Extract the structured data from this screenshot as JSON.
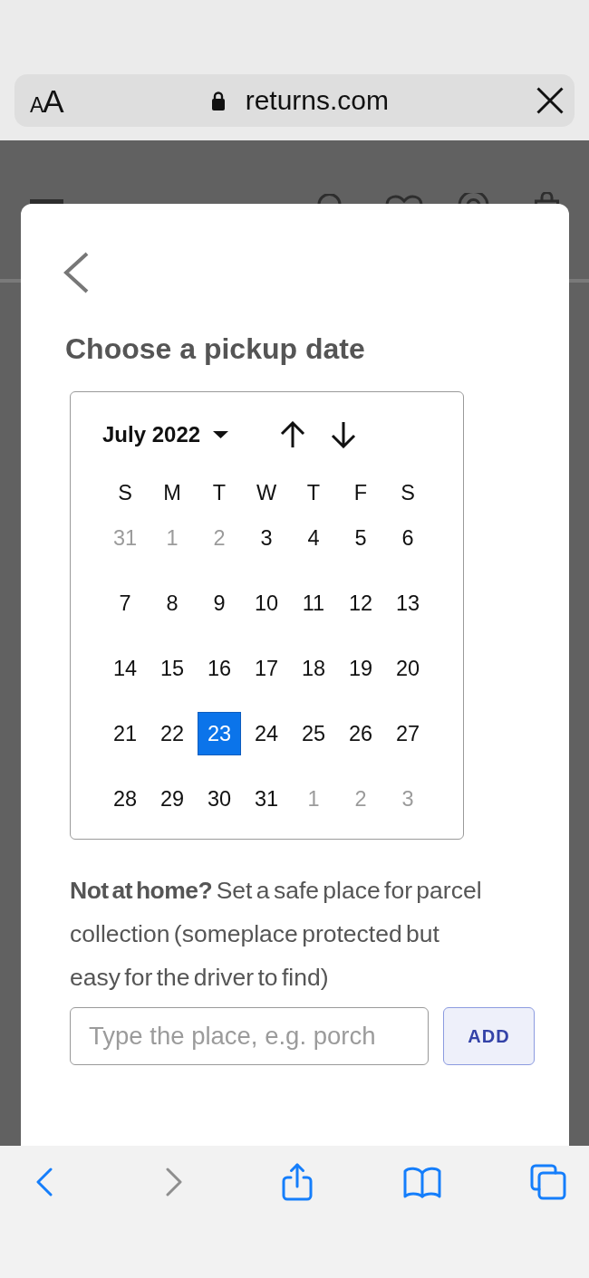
{
  "browser": {
    "text_size_button": {
      "label": "AA"
    },
    "url": "returns.com"
  },
  "modal": {
    "title": "Choose a pickup date",
    "calendar": {
      "month_label": "July 2022",
      "weekdays": [
        "S",
        "M",
        "T",
        "W",
        "T",
        "F",
        "S"
      ],
      "days": [
        {
          "day": "31",
          "in_month": false,
          "selected": false
        },
        {
          "day": "1",
          "in_month": false,
          "selected": false
        },
        {
          "day": "2",
          "in_month": false,
          "selected": false
        },
        {
          "day": "3",
          "in_month": true,
          "selected": false
        },
        {
          "day": "4",
          "in_month": true,
          "selected": false
        },
        {
          "day": "5",
          "in_month": true,
          "selected": false
        },
        {
          "day": "6",
          "in_month": true,
          "selected": false
        },
        {
          "day": "7",
          "in_month": true,
          "selected": false
        },
        {
          "day": "8",
          "in_month": true,
          "selected": false
        },
        {
          "day": "9",
          "in_month": true,
          "selected": false
        },
        {
          "day": "10",
          "in_month": true,
          "selected": false
        },
        {
          "day": "11",
          "in_month": true,
          "selected": false
        },
        {
          "day": "12",
          "in_month": true,
          "selected": false
        },
        {
          "day": "13",
          "in_month": true,
          "selected": false
        },
        {
          "day": "14",
          "in_month": true,
          "selected": false
        },
        {
          "day": "15",
          "in_month": true,
          "selected": false
        },
        {
          "day": "16",
          "in_month": true,
          "selected": false
        },
        {
          "day": "17",
          "in_month": true,
          "selected": false
        },
        {
          "day": "18",
          "in_month": true,
          "selected": false
        },
        {
          "day": "19",
          "in_month": true,
          "selected": false
        },
        {
          "day": "20",
          "in_month": true,
          "selected": false
        },
        {
          "day": "21",
          "in_month": true,
          "selected": false
        },
        {
          "day": "22",
          "in_month": true,
          "selected": false
        },
        {
          "day": "23",
          "in_month": true,
          "selected": true
        },
        {
          "day": "24",
          "in_month": true,
          "selected": false
        },
        {
          "day": "25",
          "in_month": true,
          "selected": false
        },
        {
          "day": "26",
          "in_month": true,
          "selected": false
        },
        {
          "day": "27",
          "in_month": true,
          "selected": false
        },
        {
          "day": "28",
          "in_month": true,
          "selected": false
        },
        {
          "day": "29",
          "in_month": true,
          "selected": false
        },
        {
          "day": "30",
          "in_month": true,
          "selected": false
        },
        {
          "day": "31",
          "in_month": true,
          "selected": false
        },
        {
          "day": "1",
          "in_month": false,
          "selected": false
        },
        {
          "day": "2",
          "in_month": false,
          "selected": false
        },
        {
          "day": "3",
          "in_month": false,
          "selected": false
        }
      ]
    },
    "safe_place": {
      "text": "**Not at home?** Set a safe place for parcel collection (someplace protected but easy for the driver to find)",
      "input": {
        "placeholder": "Type the place, e.g. porch"
      },
      "button": "ADD"
    }
  },
  "toolbar": {
    "buttons": [
      {
        "kind": "back",
        "disabled": false
      },
      {
        "kind": "forward",
        "disabled": true
      },
      {
        "kind": "share",
        "disabled": false
      },
      {
        "kind": "bookmarks",
        "disabled": false
      },
      {
        "kind": "tabs",
        "disabled": false
      }
    ]
  }
}
